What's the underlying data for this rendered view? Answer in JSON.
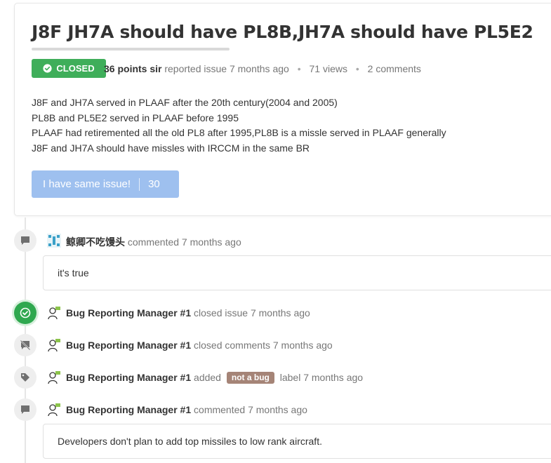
{
  "issue": {
    "title": "J8F JH7A should have PL8B,JH7A should have PL5E2",
    "status": "CLOSED",
    "author": "36 points sir",
    "reported_text": "reported issue 7 months ago",
    "views": "71 views",
    "comments_count": "2 comments",
    "body_lines": [
      "J8F and JH7A served in PLAAF after the 20th century(2004 and 2005)",
      "PL8B and PL5E2 served in PLAAF before 1995",
      "PLAAF had retiremented all the old PL8 after 1995,PL8B is a missle served in PLAAF generally",
      "J8F and JH7A should have missles with IRCCM in the same BR"
    ],
    "same_issue_label": "I have same issue!",
    "same_issue_count": "30"
  },
  "timeline": [
    {
      "icon": "comment-icon",
      "user": "鲸卿不吃馒头",
      "action": "commented 7 months ago",
      "comment": "it's true"
    },
    {
      "icon": "check-circle-icon",
      "user": "Bug Reporting Manager #1",
      "action": "closed issue 7 months ago"
    },
    {
      "icon": "comment-off-icon",
      "user": "Bug Reporting Manager #1",
      "action": "closed comments 7 months ago"
    },
    {
      "icon": "tag-icon",
      "user": "Bug Reporting Manager #1",
      "action_before": "added",
      "label": "not a bug",
      "action_after": "label 7 months ago"
    },
    {
      "icon": "comment-icon",
      "user": "Bug Reporting Manager #1",
      "action": "commented 7 months ago",
      "comment": "Developers don't plan to add top missiles to low rank aircraft."
    }
  ],
  "colors": {
    "closed_badge": "#3fae5a",
    "same_issue_button": "#9ec0ef",
    "label_not_a_bug": "#a58477"
  }
}
